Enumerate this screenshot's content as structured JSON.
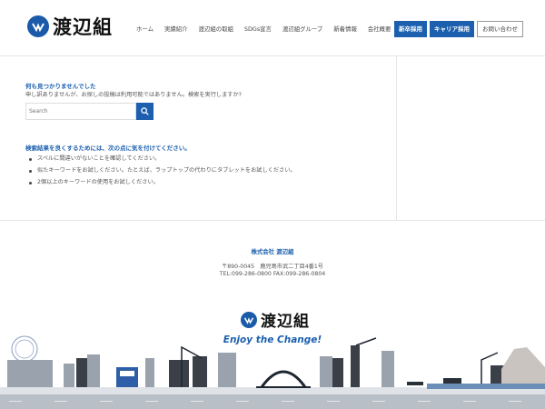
{
  "header": {
    "logo_text": "渡辺組",
    "nav": [
      "ホーム",
      "実績紹介",
      "渡辺組の取組",
      "SDGs宣言",
      "渡辺組グループ",
      "新着情報",
      "会社概要"
    ],
    "buttons": {
      "new_grad": "新卒採用",
      "career": "キャリア採用",
      "contact": "お問い合わせ"
    }
  },
  "main": {
    "not_found_title": "何も見つかりませんでした",
    "not_found_desc": "申し訳ありませんが、お探しの投稿は利用可能ではありません。検索を実行しますか?",
    "search": {
      "placeholder": "Search",
      "value": ""
    },
    "tips_title": "検索結果を良くするためには、次の点に気を付けてください。",
    "tips": [
      "スペルに間違いがないことを確認してください。",
      "似たキーワードをお試しください。たとえば、ラップトップの代わりにタブレットをお試しください。",
      "2個以上のキーワードの使用をお試しください。"
    ]
  },
  "footer": {
    "company": "株式会社 渡辺組",
    "address": "〒890-0045　鹿児島市武二丁目4番1号",
    "tel": "TEL:099-286-0800 FAX:099-286-0804",
    "logo_text": "渡辺組",
    "slogan": "Enjoy the Change!"
  },
  "colors": {
    "brand": "#1b5fae",
    "text": "#444444",
    "border": "#e6e6e6"
  }
}
